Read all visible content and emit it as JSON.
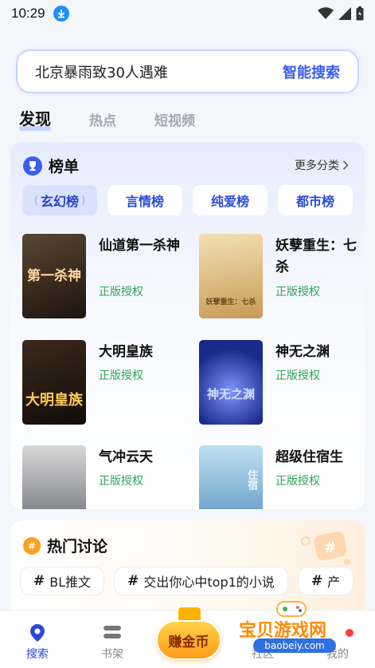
{
  "status_bar": {
    "time": "10:29"
  },
  "search": {
    "query": "北京暴雨致30人遇难",
    "button": "智能搜索"
  },
  "tabs": [
    "发现",
    "热点",
    "短视频"
  ],
  "rank": {
    "title": "榜单",
    "more": "更多分类",
    "categories": [
      "玄幻榜",
      "言情榜",
      "纯爱榜",
      "都市榜"
    ],
    "books": [
      {
        "name": "仙道第一杀神",
        "tag": "正版授权",
        "cover_text": "第一杀神",
        "cover_color": "#3a2a1e"
      },
      {
        "name": "妖孽重生：七杀",
        "tag": "正版授权",
        "cover_text": "妖孽重生：七杀",
        "cover_color": "#d8b87a"
      },
      {
        "name": "大明皇族",
        "tag": "正版授权",
        "cover_text": "大明皇族",
        "cover_color": "#2a1a12"
      },
      {
        "name": "神无之渊",
        "tag": "正版授权",
        "cover_text": "神无之渊",
        "cover_color": "#2e3fa6"
      },
      {
        "name": "气冲云天",
        "tag": "正版授权",
        "cover_text": "",
        "cover_color": "#8a8f99"
      },
      {
        "name": "超级住宿生",
        "tag": "正版授权",
        "cover_text": "住宿",
        "cover_color": "#7fb7d8"
      }
    ]
  },
  "discussion": {
    "title": "热门讨论",
    "topics": [
      "BL推文",
      "交出你心中top1的小说",
      "产"
    ]
  },
  "bottom_nav": {
    "search": "搜索",
    "shelf": "书架",
    "earn": "赚金币",
    "community": "社区",
    "mine": "我的"
  },
  "watermark": {
    "title": "宝贝游戏网",
    "url": "baobeiy.com"
  },
  "colors": {
    "accent": "#3a5bf0",
    "tag_green": "#2fa35a",
    "earn_orange": "#ff9c1a"
  }
}
